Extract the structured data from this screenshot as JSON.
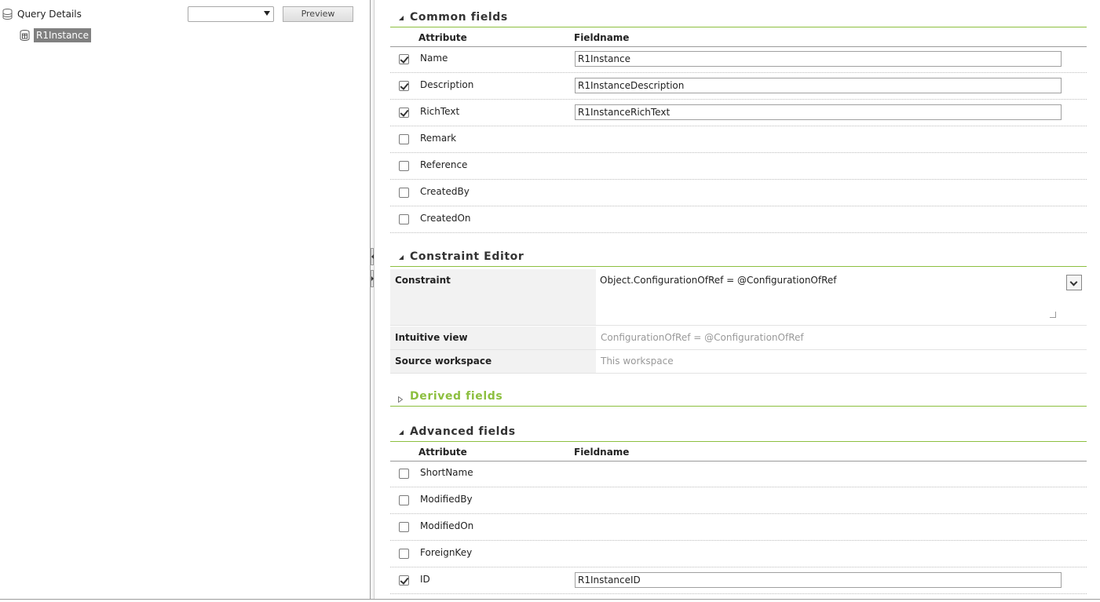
{
  "tree": {
    "root_label": "Query Details",
    "child_label": "R1Instance"
  },
  "toolbar": {
    "view_select_value": "",
    "preview_label": "Preview"
  },
  "common_fields": {
    "title": "Common fields",
    "col_attribute": "Attribute",
    "col_fieldname": "Fieldname",
    "rows": [
      {
        "attribute": "Name",
        "checked": true,
        "fieldname": "R1Instance"
      },
      {
        "attribute": "Description",
        "checked": true,
        "fieldname": "R1InstanceDescription"
      },
      {
        "attribute": "RichText",
        "checked": true,
        "fieldname": "R1InstanceRichText"
      },
      {
        "attribute": "Remark",
        "checked": false,
        "fieldname": ""
      },
      {
        "attribute": "Reference",
        "checked": false,
        "fieldname": ""
      },
      {
        "attribute": "CreatedBy",
        "checked": false,
        "fieldname": ""
      },
      {
        "attribute": "CreatedOn",
        "checked": false,
        "fieldname": ""
      }
    ]
  },
  "constraint_editor": {
    "title": "Constraint Editor",
    "constraint_label": "Constraint",
    "constraint_value": "Object.ConfigurationOfRef = @ConfigurationOfRef",
    "intuitive_label": "Intuitive view",
    "intuitive_value": "ConfigurationOfRef = @ConfigurationOfRef",
    "source_label": "Source workspace",
    "source_value": "This workspace"
  },
  "derived_fields": {
    "title": "Derived fields"
  },
  "advanced_fields": {
    "title": "Advanced fields",
    "col_attribute": "Attribute",
    "col_fieldname": "Fieldname",
    "rows": [
      {
        "attribute": "ShortName",
        "checked": false,
        "fieldname": ""
      },
      {
        "attribute": "ModifiedBy",
        "checked": false,
        "fieldname": ""
      },
      {
        "attribute": "ModifiedOn",
        "checked": false,
        "fieldname": ""
      },
      {
        "attribute": "ForeignKey",
        "checked": false,
        "fieldname": ""
      },
      {
        "attribute": "ID",
        "checked": true,
        "fieldname": "R1InstanceID"
      }
    ]
  },
  "colors": {
    "accent_green": "#8cbf3f",
    "selection_gray": "#808080"
  }
}
